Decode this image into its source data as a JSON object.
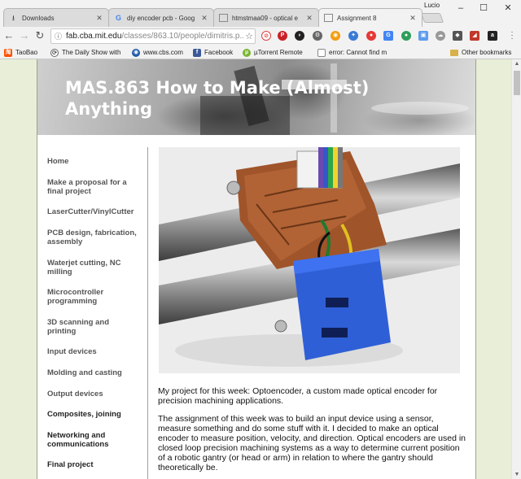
{
  "browser": {
    "tabs": [
      {
        "title": "Downloads",
        "icon": "download-icon"
      },
      {
        "title": "diy encoder pcb - Goog",
        "icon": "google-icon"
      },
      {
        "title": "htmstmaa09 - optical e",
        "icon": "page-icon"
      },
      {
        "title": "Assignment 8",
        "icon": "page-icon"
      }
    ],
    "user": "Lucio",
    "url_host": "fab.cba.mit.edu",
    "url_path": "/classes/863.10/people/dimitris.p...",
    "bookmarks": [
      {
        "label": "TaoBao"
      },
      {
        "label": "The Daily Show with"
      },
      {
        "label": "www.cbs.com"
      },
      {
        "label": "Facebook"
      },
      {
        "label": "µTorrent Remote"
      },
      {
        "label": "error: Cannot find m"
      },
      {
        "label": "Other bookmarks"
      }
    ]
  },
  "page": {
    "banner_title": "MAS.863 How to Make (Almost) Anything",
    "nav": [
      "Home",
      "Make a proposal for a final project",
      "LaserCutter/VinylCutter",
      "PCB design, fabrication, assembly",
      "Waterjet cutting, NC milling",
      "Microcontroller programming",
      "3D scanning and printing",
      "Input devices",
      "Molding and casting",
      "Output devices",
      "Composites, joining",
      "Networking and communications",
      "Final project"
    ],
    "paragraphs": [
      "My project for this week: Optoencoder, a custom made optical encoder for precision machining applications.",
      "The assignment of this week was to build an input device using a sensor, measure something and do some stuff with it. I decided to make an optical encoder to measure position, velocity, and direction. Optical encoders are used in closed loop precision machining systems as a way to determine current position of a robotic gantry (or head or arm) in relation to where the gantry should theoretically be."
    ]
  }
}
